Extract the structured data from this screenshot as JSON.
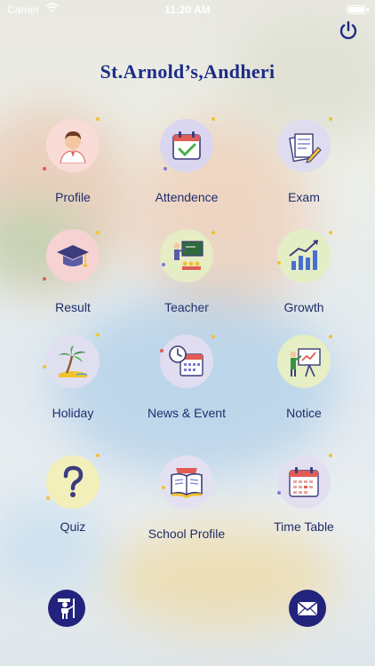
{
  "status_bar": {
    "carrier": "Carrier",
    "time": "11:20 AM",
    "battery": 1.0
  },
  "header": {
    "title": "St.Arnold’s,Andheri",
    "power_icon": "power-icon"
  },
  "tiles": [
    {
      "label": "Profile",
      "icon": "profile-icon",
      "color": "#f9dbd7"
    },
    {
      "label": "Attendence",
      "icon": "attendance-icon",
      "color": "#dad6ef"
    },
    {
      "label": "Exam",
      "icon": "exam-icon",
      "color": "#dfdcef"
    },
    {
      "label": "Result",
      "icon": "graduation-cap-icon",
      "color": "#f6d3d2"
    },
    {
      "label": "Teacher",
      "icon": "teacher-icon",
      "color": "#e6ecc4"
    },
    {
      "label": "Growth",
      "icon": "growth-chart-icon",
      "color": "#e4eec4"
    },
    {
      "label": "Holiday",
      "icon": "palm-tree-icon",
      "color": "#e0dff0"
    },
    {
      "label": "News & Event",
      "icon": "calendar-clock-icon",
      "color": "#e0ddf0"
    },
    {
      "label": "Notice",
      "icon": "notice-board-icon",
      "color": "#e6eec3"
    },
    {
      "label": "Quiz",
      "icon": "question-mark-icon",
      "color": "#f2efbb"
    },
    {
      "label": "School Profile",
      "icon": "book-icon",
      "color": "#e3e1f1"
    },
    {
      "label": "Time Table",
      "icon": "timetable-icon",
      "color": "#e2e0f0"
    }
  ],
  "bottom_bar": {
    "left_icon": "teacher-figure-icon",
    "right_icon": "mail-icon",
    "accent": "#22237d"
  }
}
